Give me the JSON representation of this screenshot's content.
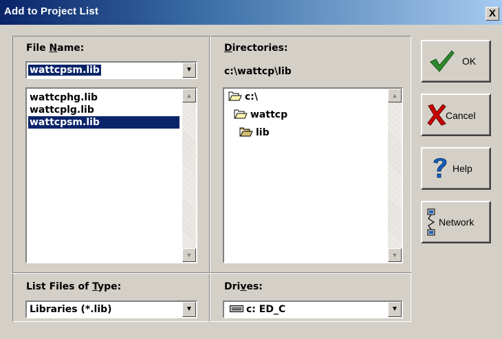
{
  "window": {
    "title": "Add to Project List",
    "close_label": "X"
  },
  "file_name": {
    "label_pre": "File ",
    "label_key": "N",
    "label_post": "ame:",
    "value": "wattcpsm.lib",
    "files": [
      "wattcphg.lib",
      "wattcplg.lib",
      "wattcpsm.lib"
    ],
    "selected_index": 2
  },
  "directories": {
    "label_key": "D",
    "label_post": "irectories:",
    "current_path": "c:\\wattcp\\lib",
    "tree": [
      "c:\\",
      "wattcp",
      "lib"
    ]
  },
  "list_type": {
    "label_pre": "List Files of ",
    "label_key": "T",
    "label_post": "ype:",
    "value": "Libraries (*.lib)"
  },
  "drives": {
    "label_pre": "Dri",
    "label_key": "v",
    "label_post": "es:",
    "value": "c: ED_C"
  },
  "buttons": {
    "ok": "OK",
    "cancel": "Cancel",
    "help": "Help",
    "network": "Network"
  },
  "colors": {
    "titlebar": "#0a246a",
    "selection": "#0a246a",
    "ok_check": "#2e8b2e",
    "cancel_x": "#cc0000",
    "help_q": "#1560bd"
  }
}
